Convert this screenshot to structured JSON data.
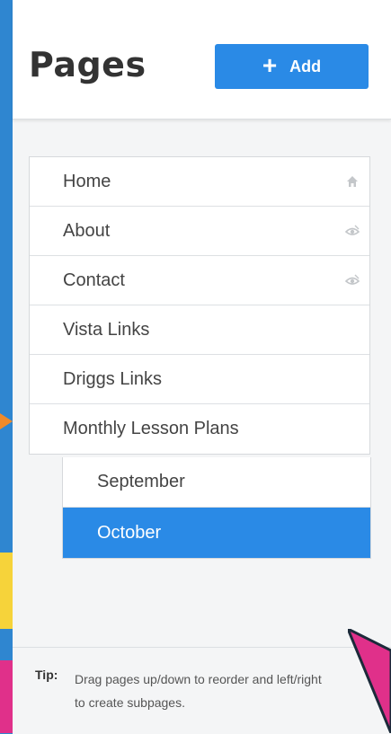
{
  "header": {
    "title": "Pages",
    "add_button": {
      "label": "Add",
      "icon": "plus-icon"
    }
  },
  "pages": [
    {
      "label": "Home",
      "icon": "home-icon"
    },
    {
      "label": "About",
      "icon": "hidden-eye-icon"
    },
    {
      "label": "Contact",
      "icon": "hidden-eye-icon"
    },
    {
      "label": "Vista Links",
      "icon": ""
    },
    {
      "label": "Driggs Links",
      "icon": ""
    },
    {
      "label": "Monthly Lesson Plans",
      "icon": ""
    }
  ],
  "subpages": [
    {
      "label": "September",
      "active": false
    },
    {
      "label": "October",
      "active": true
    }
  ],
  "tip": {
    "label": "Tip:",
    "text": "Drag pages up/down to reorder and left/right to create subpages."
  },
  "colors": {
    "accent": "#2a8ae6",
    "background": "#2f86d0",
    "deco_pink": "#e0308a",
    "deco_yellow": "#f6d33a"
  }
}
